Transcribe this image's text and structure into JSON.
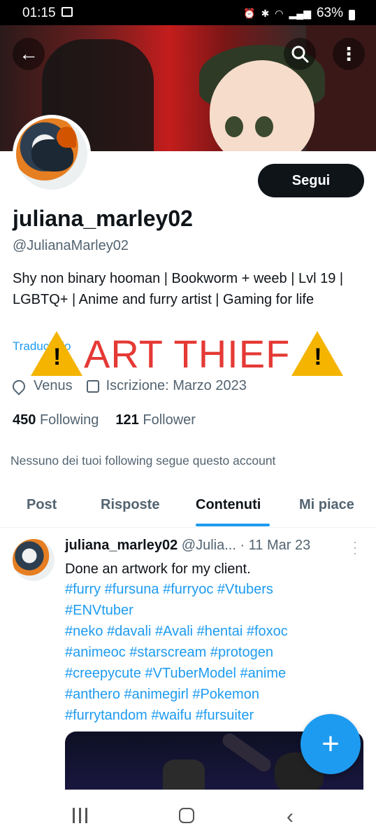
{
  "status_bar": {
    "time": "01:15",
    "battery": "63%"
  },
  "colors": {
    "accent": "#1d9bf0",
    "warning_text": "#e53935",
    "warning_sign": "#f4b400",
    "follow_button": "#0f1419"
  },
  "profile": {
    "display_name": "juliana_marley02",
    "handle": "@JulianaMarley02",
    "bio": "Shy non binary hooman | Bookworm + weeb | Lvl 19 | LGBTQ+ | Anime and furry artist | Gaming for life",
    "translate_label": "Traduci bio",
    "location": "Venus",
    "joined": "Iscrizione: Marzo 2023",
    "following_count": "450",
    "following_label": "Following",
    "follower_count": "121",
    "follower_label": "Follower",
    "notice": "Nessuno dei tuoi following segue questo account",
    "follow_button": "Segui"
  },
  "overlay": {
    "text": "ART THIEF",
    "icon": "warning-icon"
  },
  "tabs": [
    {
      "label": "Post"
    },
    {
      "label": "Risposte"
    },
    {
      "label": "Contenuti",
      "active": true
    },
    {
      "label": "Mi piace"
    }
  ],
  "tweet": {
    "name": "juliana_marley02",
    "handle": "@Julia...",
    "date": "· 11 Mar 23",
    "text": "Done an artwork for my client.",
    "hashtag_lines": [
      "#furry #fursuna #furryoc #Vtubers",
      "#ENVtuber",
      "#neko #davali #Avali #hentai #foxoc",
      "#animeoc #starscream #protogen",
      "#creepycute #VTuberModel #anime",
      "#anthero #animegirl #Pokemon",
      "#furrytandom #waifu #fursuiter"
    ]
  },
  "fab": {
    "icon": "plus-icon"
  }
}
